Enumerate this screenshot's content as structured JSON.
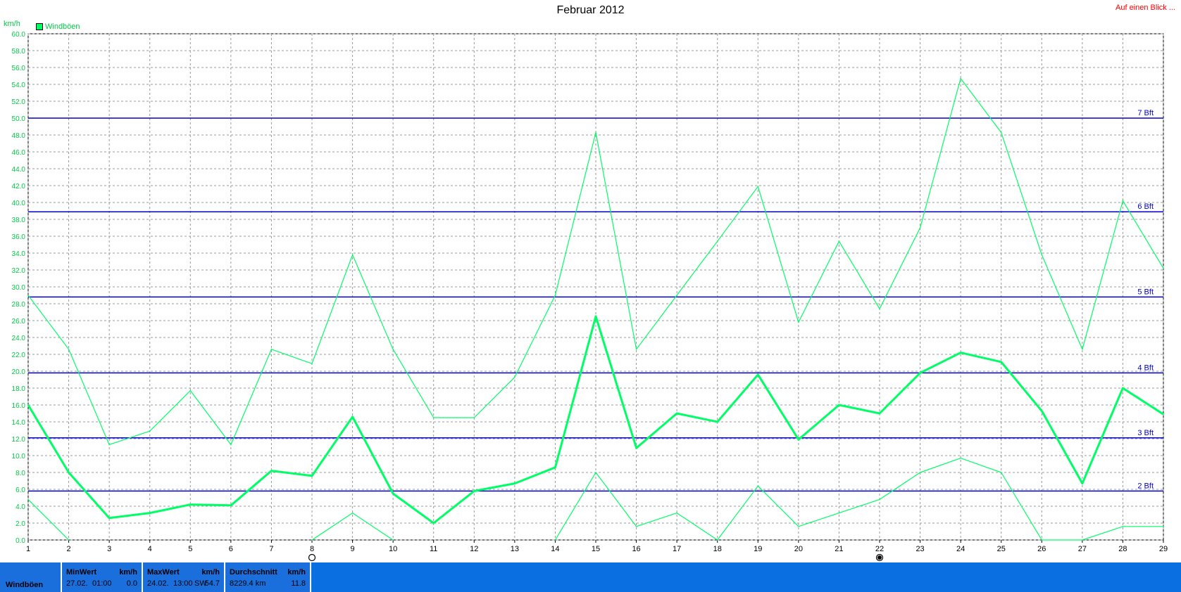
{
  "header": {
    "title": "Februar 2012",
    "link_label": "Auf einen Blick ...",
    "unit_label": "km/h"
  },
  "legend": {
    "label": "Windböen",
    "color": "#00ff66"
  },
  "chart_data": {
    "type": "line",
    "title": "Februar 2012",
    "ylabel": "km/h",
    "xlabel": "",
    "ylim": [
      0,
      60
    ],
    "y_step": 2,
    "xlim": [
      1,
      29
    ],
    "categories": [
      1,
      2,
      3,
      4,
      5,
      6,
      7,
      8,
      9,
      10,
      11,
      12,
      13,
      14,
      15,
      16,
      17,
      18,
      19,
      20,
      21,
      22,
      23,
      24,
      25,
      26,
      27,
      28,
      29
    ],
    "grid": true,
    "legend_position": "top-left",
    "series": [
      {
        "name": "Windböen",
        "role": "max",
        "color": "#00ff66",
        "values": [
          29.0,
          22.6,
          11.3,
          12.9,
          17.7,
          11.3,
          22.6,
          20.9,
          33.8,
          22.6,
          14.5,
          14.5,
          19.3,
          29.0,
          48.3,
          22.6,
          29.0,
          35.4,
          41.9,
          25.8,
          35.4,
          27.4,
          37.0,
          54.7,
          48.3,
          33.8,
          22.6,
          40.2,
          32.2
        ]
      },
      {
        "name": "Windböen",
        "role": "avg",
        "color": "#00ff66",
        "values": [
          16.0,
          8.0,
          2.6,
          3.2,
          4.2,
          4.1,
          8.2,
          7.6,
          14.6,
          5.5,
          2.0,
          5.8,
          6.7,
          8.6,
          26.5,
          10.9,
          15.0,
          14.0,
          19.6,
          11.9,
          16.0,
          15.0,
          19.8,
          22.2,
          21.1,
          15.3,
          6.7,
          18.0,
          14.9
        ]
      },
      {
        "name": "Windböen",
        "role": "min",
        "color": "#00ff66",
        "values": [
          4.8,
          0.0,
          null,
          null,
          null,
          null,
          null,
          0.0,
          3.2,
          0.0,
          null,
          null,
          null,
          0.0,
          8.0,
          1.6,
          3.2,
          0.0,
          6.4,
          1.6,
          3.2,
          4.8,
          8.0,
          9.7,
          8.0,
          0.0,
          0.0,
          1.6,
          1.6
        ]
      }
    ],
    "reference_lines": [
      {
        "label": "7 Bft",
        "value": 50.0
      },
      {
        "label": "6 Bft",
        "value": 38.9
      },
      {
        "label": "5 Bft",
        "value": 28.8
      },
      {
        "label": "4 Bft",
        "value": 19.8
      },
      {
        "label": "3 Bft",
        "value": 12.1
      },
      {
        "label": "2 Bft",
        "value": 5.8
      }
    ],
    "markers": [
      {
        "x": 8,
        "type": "open-circle"
      },
      {
        "x": 22,
        "type": "filled-circle"
      }
    ]
  },
  "footer": {
    "row_label": "Windböen",
    "min_header": "MinWert",
    "min_unit": "km/h",
    "min_date": "27.02.",
    "min_time": "01:00",
    "min_value": "0.0",
    "max_header": "MaxWert",
    "max_unit": "km/h",
    "max_date": "24.02.",
    "max_time": "13:00",
    "max_dir": "SW",
    "max_value": "54.7",
    "avg_header": "Durchschnitt",
    "avg_unit": "km/h",
    "avg_distance": "8229.4 km",
    "avg_value": "11.8"
  }
}
